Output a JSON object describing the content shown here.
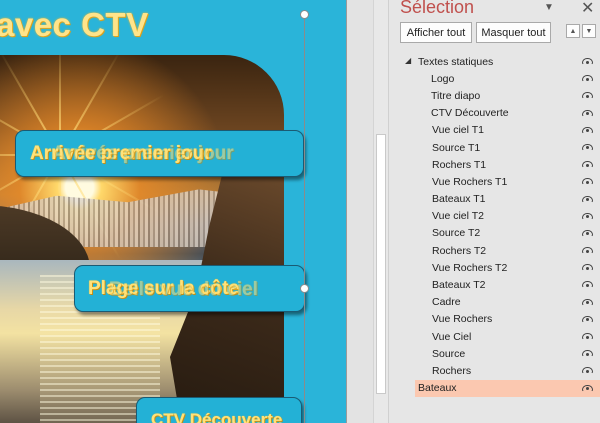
{
  "slide": {
    "title": "avec CTV",
    "banner1_text": "Arrivée premier jour",
    "banner1_ghost": "Arrivée premier jour",
    "banner2_text": "Plage sur la côte",
    "banner2_ghost": "Belle vue du ciel",
    "banner3_text": "CTV Découverte"
  },
  "selection_pane": {
    "title": "Sélection",
    "show_all": "Afficher tout",
    "hide_all": "Masquer tout",
    "items": [
      {
        "label": "Textes statiques",
        "level": 0,
        "group": true
      },
      {
        "label": "Logo",
        "level": 1
      },
      {
        "label": "Titre diapo",
        "level": 1
      },
      {
        "label": "CTV Découverte",
        "level": 1
      },
      {
        "label": "Vue ciel T1",
        "level": 2
      },
      {
        "label": "Source T1",
        "level": 2
      },
      {
        "label": "Rochers T1",
        "level": 2
      },
      {
        "label": "Vue Rochers T1",
        "level": 2
      },
      {
        "label": "Bateaux T1",
        "level": 2
      },
      {
        "label": "Vue ciel T2",
        "level": 2
      },
      {
        "label": "Source T2",
        "level": 2
      },
      {
        "label": "Rochers T2",
        "level": 2
      },
      {
        "label": "Vue Rochers T2",
        "level": 2
      },
      {
        "label": "Bateaux T2",
        "level": 2
      },
      {
        "label": "Cadre",
        "level": 2
      },
      {
        "label": "Vue Rochers",
        "level": 2
      },
      {
        "label": "Vue Ciel",
        "level": 2
      },
      {
        "label": "Source",
        "level": 2
      },
      {
        "label": "Rochers",
        "level": 2
      },
      {
        "label": "Bateaux",
        "level": 2,
        "selected": true
      }
    ]
  },
  "colors": {
    "slide_bg": "#2ab4d9",
    "title_text": "#ffe48a",
    "pane_title": "#c0504d",
    "selected_row": "#fbc8b0"
  },
  "icons": {
    "visibility": "eye-icon",
    "collapse": "caret-down-icon",
    "close": "close-icon",
    "move_up": "arrow-up-icon",
    "move_down": "arrow-down-icon"
  }
}
